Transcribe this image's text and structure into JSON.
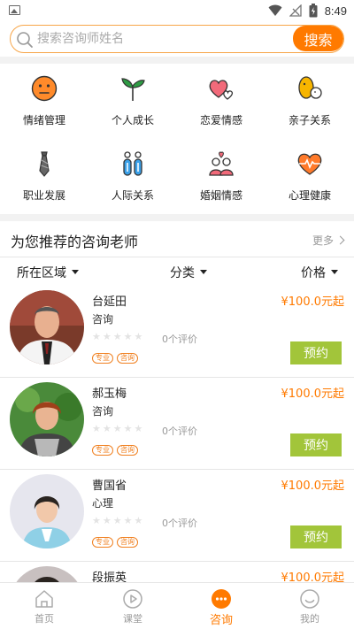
{
  "status_bar": {
    "time": "8:49"
  },
  "search": {
    "placeholder": "搜索咨询师姓名",
    "button_label": "搜索"
  },
  "categories": [
    {
      "label": "情绪管理",
      "icon": "emotion-face-icon"
    },
    {
      "label": "个人成长",
      "icon": "sprout-icon"
    },
    {
      "label": "恋爱情感",
      "icon": "hearts-icon"
    },
    {
      "label": "亲子关系",
      "icon": "parent-child-icon"
    },
    {
      "label": "职业发展",
      "icon": "tie-icon"
    },
    {
      "label": "人际关系",
      "icon": "people-icon"
    },
    {
      "label": "婚姻情感",
      "icon": "couple-icon"
    },
    {
      "label": "心理健康",
      "icon": "heartbeat-icon"
    }
  ],
  "recommend": {
    "title": "为您推荐的咨询老师",
    "more": "更多",
    "filters": {
      "region": "所在区域",
      "category": "分类",
      "price": "价格"
    },
    "counselors": [
      {
        "name": "台延田",
        "type": "咨询",
        "reviews": "0个评价",
        "tags": [
          "专业",
          "咨询"
        ],
        "price": "¥100.0元起",
        "book": "预约"
      },
      {
        "name": "郝玉梅",
        "type": "咨询",
        "reviews": "0个评价",
        "tags": [
          "专业",
          "咨询"
        ],
        "price": "¥100.0元起",
        "book": "预约"
      },
      {
        "name": "曹国省",
        "type": "心理",
        "reviews": "0个评价",
        "tags": [
          "专业",
          "咨询"
        ],
        "price": "¥100.0元起",
        "book": "预约"
      },
      {
        "name": "段振英",
        "type": "",
        "reviews": "",
        "tags": [],
        "price": "¥100.0元起",
        "book": ""
      }
    ]
  },
  "tabs": [
    {
      "label": "首页",
      "icon": "home-icon",
      "active": false
    },
    {
      "label": "课堂",
      "icon": "play-circle-icon",
      "active": false
    },
    {
      "label": "咨询",
      "icon": "chat-bubble-icon",
      "active": true
    },
    {
      "label": "我的",
      "icon": "smile-icon",
      "active": false
    }
  ],
  "colors": {
    "accent": "#ff7a00",
    "book_button": "#a2c53a",
    "tag": "#f08020"
  }
}
